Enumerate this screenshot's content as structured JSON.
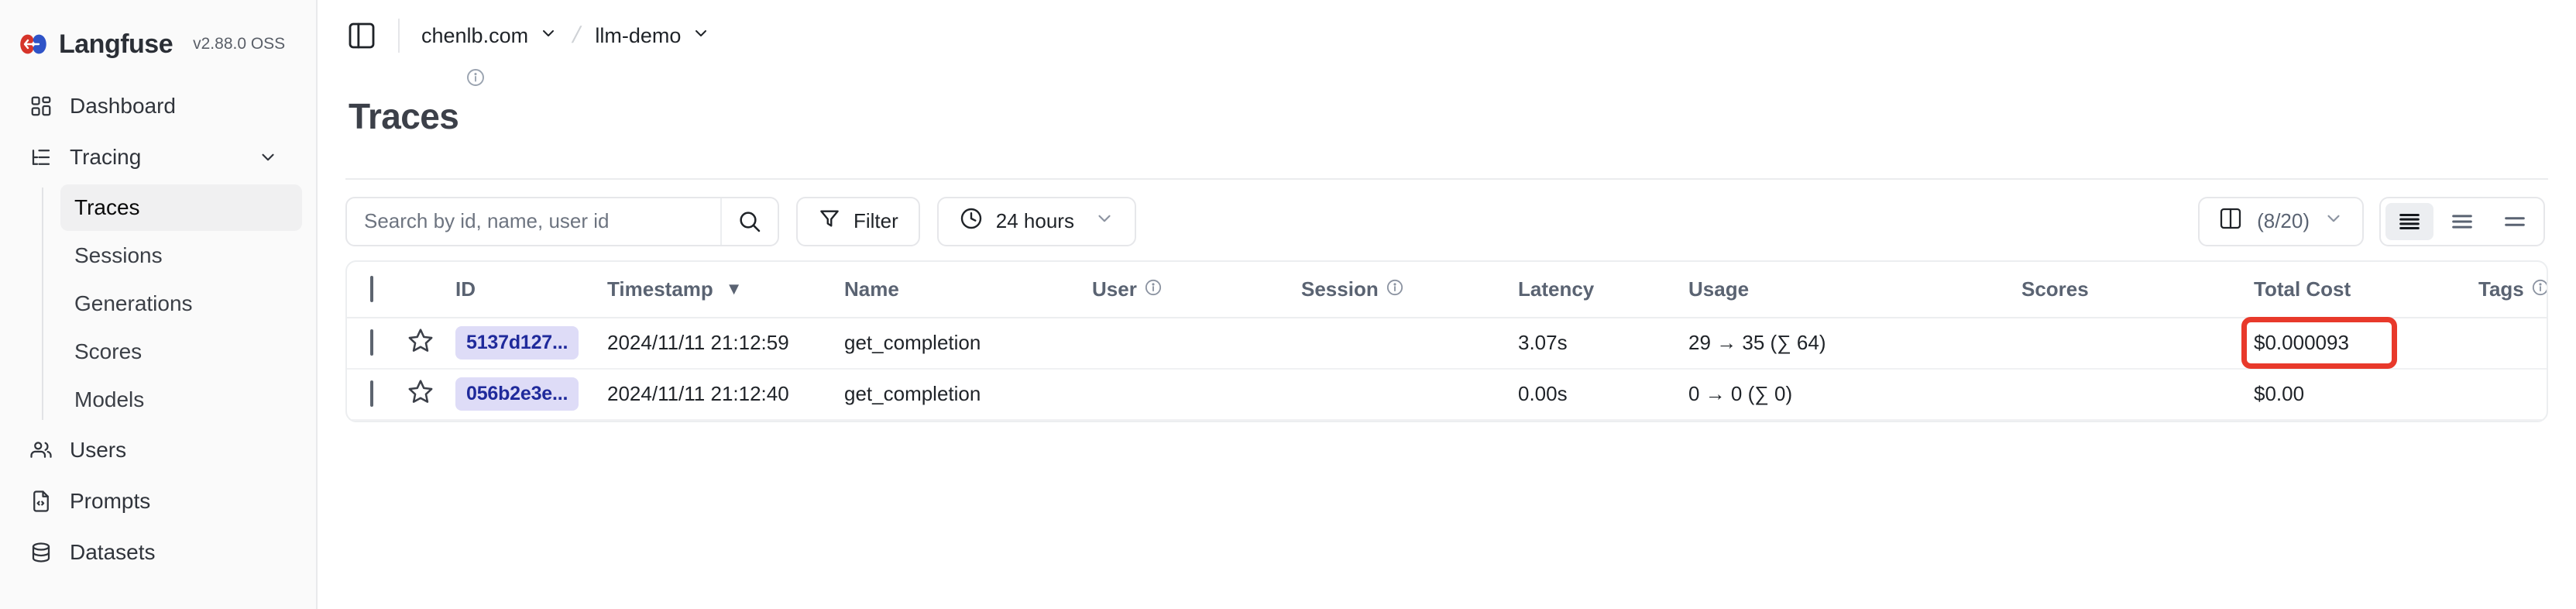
{
  "brand": {
    "name": "Langfuse",
    "version": "v2.88.0 OSS",
    "logo_icon": "langfuse-logo-icon"
  },
  "sidebar": {
    "items": [
      {
        "label": "Dashboard",
        "icon": "layout-dashboard-icon"
      },
      {
        "label": "Tracing",
        "icon": "list-tree-icon",
        "chevron": "chevron-down-icon"
      }
    ],
    "subitems": [
      {
        "label": "Traces",
        "active": true
      },
      {
        "label": "Sessions",
        "active": false
      },
      {
        "label": "Generations",
        "active": false
      },
      {
        "label": "Scores",
        "active": false
      },
      {
        "label": "Models",
        "active": false
      }
    ],
    "bottom_items": [
      {
        "label": "Users",
        "icon": "users-icon"
      },
      {
        "label": "Prompts",
        "icon": "file-code-icon"
      },
      {
        "label": "Datasets",
        "icon": "database-icon"
      }
    ]
  },
  "topbar": {
    "panel_toggle_icon": "panel-left-icon",
    "breadcrumb": {
      "org": "chenlb.com",
      "org_chevron": "chevron-down-icon",
      "separator": "/",
      "project": "llm-demo",
      "project_chevron": "chevron-down-icon"
    }
  },
  "page": {
    "title": "Traces",
    "info_icon": "info-icon"
  },
  "toolbar": {
    "search": {
      "placeholder": "Search by id, name, user id",
      "value": "",
      "icon": "search-icon"
    },
    "filter": {
      "label": "Filter",
      "icon": "filter-icon"
    },
    "time_range": {
      "label": "24 hours",
      "icon": "clock-icon",
      "chevron": "chevron-down-icon"
    },
    "columns": {
      "label": "(8/20)",
      "icon": "columns-icon",
      "chevron": "chevron-down-icon"
    },
    "view_modes": [
      {
        "name": "rows-expanded",
        "active": true
      },
      {
        "name": "rows-default",
        "active": false
      },
      {
        "name": "rows-compact",
        "active": false
      }
    ]
  },
  "table": {
    "columns": [
      {
        "key": "select",
        "label": "",
        "icon": "checkbox-icon"
      },
      {
        "key": "star",
        "label": ""
      },
      {
        "key": "id",
        "label": "ID"
      },
      {
        "key": "timestamp",
        "label": "Timestamp",
        "sort": "desc",
        "sort_icon": "caret-down-icon"
      },
      {
        "key": "name",
        "label": "Name"
      },
      {
        "key": "user",
        "label": "User",
        "info_icon": "info-icon"
      },
      {
        "key": "session",
        "label": "Session",
        "info_icon": "info-icon"
      },
      {
        "key": "latency",
        "label": "Latency"
      },
      {
        "key": "usage",
        "label": "Usage"
      },
      {
        "key": "scores",
        "label": "Scores"
      },
      {
        "key": "total_cost",
        "label": "Total Cost"
      },
      {
        "key": "tags",
        "label": "Tags",
        "info_icon": "info-icon"
      }
    ],
    "rows": [
      {
        "id": "5137d127...",
        "timestamp": "2024/11/11 21:12:59",
        "name": "get_completion",
        "user": "",
        "session": "",
        "latency": "3.07s",
        "usage": "29 → 35 (∑ 64)",
        "scores": "",
        "total_cost": "$0.000093",
        "tags": "",
        "highlight_cost": true
      },
      {
        "id": "056b2e3e...",
        "timestamp": "2024/11/11 21:12:40",
        "name": "get_completion",
        "user": "",
        "session": "",
        "latency": "0.00s",
        "usage": "0 → 0 (∑ 0)",
        "scores": "",
        "total_cost": "$0.00",
        "tags": "",
        "highlight_cost": false
      }
    ]
  },
  "colors": {
    "sidebar_bg": "#fafafa",
    "id_pill_bg": "#dedcf7",
    "id_pill_text": "#1f2a9b",
    "annotation_red": "#e8392b",
    "active_nav_bg": "#f0f0f1",
    "header_text": "#5a6372"
  }
}
